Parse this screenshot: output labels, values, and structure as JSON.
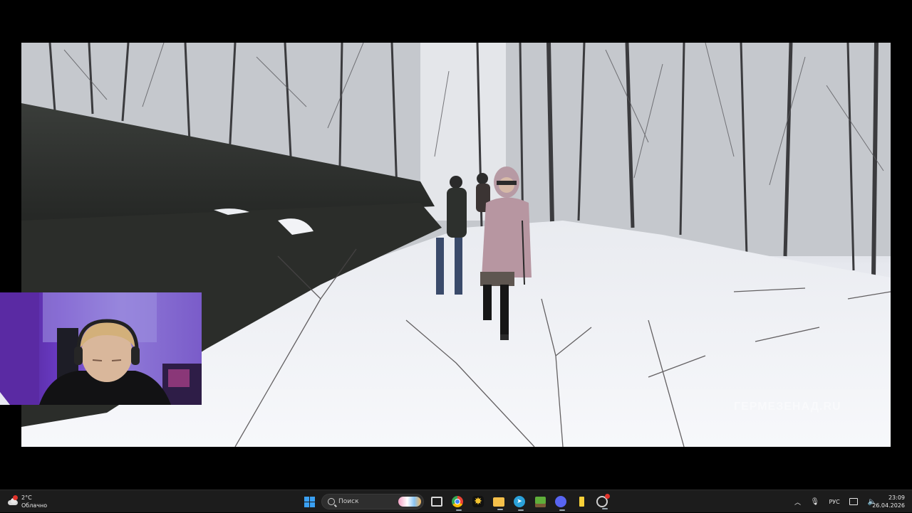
{
  "video": {
    "watermark": "ГЕРМЕЗЕНАД.RU"
  },
  "taskbar": {
    "weather": {
      "temperature": "2°C",
      "condition": "Облачно",
      "badge_color": "#e0332b"
    },
    "search": {
      "placeholder": "Поиск"
    },
    "apps": [
      {
        "icon": "task-view-icon",
        "color": "#d9d9d9"
      },
      {
        "icon": "chrome-icon",
        "color": "#4285f4"
      },
      {
        "icon": "sparkle-app-icon",
        "color": "#f4c430"
      },
      {
        "icon": "file-explorer-icon",
        "color": "#f5c04a"
      },
      {
        "icon": "telegram-icon",
        "color": "#2aa1da"
      },
      {
        "icon": "minecraft-icon",
        "color": "#5fae3a"
      },
      {
        "icon": "discord-icon",
        "color": "#5865f2"
      },
      {
        "icon": "battery-app-icon",
        "color": "#f7d038"
      },
      {
        "icon": "obs-icon",
        "color": "#d0d0d0"
      }
    ],
    "tray": {
      "language": "РУС"
    },
    "clock": {
      "time": "23:09",
      "date": "26.04.2026"
    },
    "accent": "#3aa0f3"
  }
}
